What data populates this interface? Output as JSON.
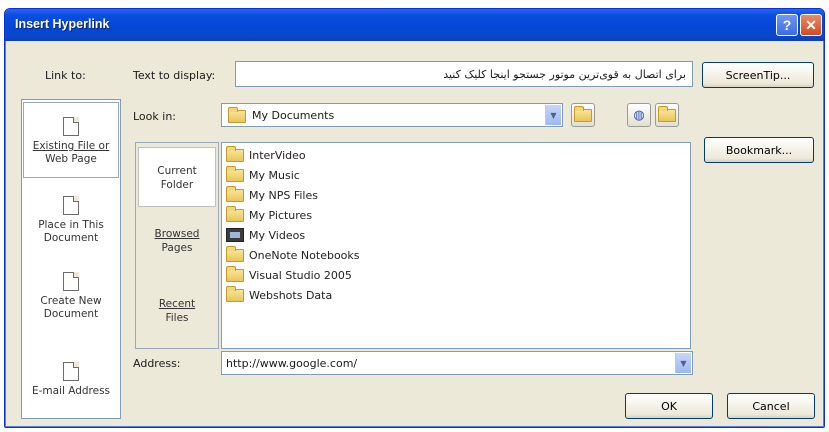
{
  "window": {
    "title": "Insert Hyperlink",
    "help_glyph": "?",
    "close_glyph": "✕"
  },
  "link_to": {
    "label": "Link to:",
    "items": [
      {
        "line1": "Existing File or",
        "line2": "Web Page",
        "icon": "web-page-icon"
      },
      {
        "line1": "Place in This",
        "line2": "Document",
        "icon": "place-document-icon"
      },
      {
        "line1": "Create New",
        "line2": "Document",
        "icon": "new-document-icon"
      },
      {
        "line1": "E-mail Address",
        "line2": "",
        "icon": "email-icon"
      }
    ]
  },
  "text_to_display": {
    "label": "Text to display:",
    "value": "برای اتصال به قوی‌ترین موتور جستجو اینجا کلیک کنید"
  },
  "screen_tip_button": "ScreenTip...",
  "look_in": {
    "label": "Look in:",
    "value": "My Documents"
  },
  "bookmark_button": "Bookmark...",
  "places": [
    {
      "line1": "Current",
      "line2": "Folder"
    },
    {
      "line1": "Browsed",
      "line2": "Pages"
    },
    {
      "line1": "Recent",
      "line2": "Files"
    }
  ],
  "files": [
    {
      "name": "InterVideo",
      "icon": "folder-icon"
    },
    {
      "name": "My Music",
      "icon": "folder-icon"
    },
    {
      "name": "My NPS Files",
      "icon": "folder-icon"
    },
    {
      "name": "My Pictures",
      "icon": "folder-icon"
    },
    {
      "name": "My Videos",
      "icon": "video-folder-icon"
    },
    {
      "name": "OneNote Notebooks",
      "icon": "folder-icon"
    },
    {
      "name": "Visual Studio 2005",
      "icon": "folder-icon"
    },
    {
      "name": "Webshots Data",
      "icon": "folder-icon"
    }
  ],
  "address": {
    "label": "Address:",
    "value": "http://www.google.com/"
  },
  "ok_button": "OK",
  "cancel_button": "Cancel",
  "dropdown_glyph": "▼"
}
